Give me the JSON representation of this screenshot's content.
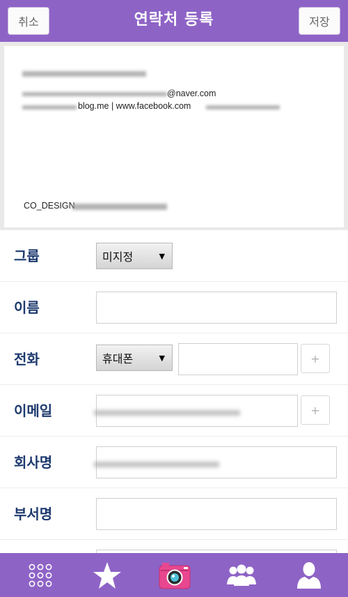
{
  "header": {
    "cancel_label": "취소",
    "title": "연락처 등록",
    "save_label": "저장"
  },
  "card": {
    "email_suffix": "@naver.com",
    "web_line": "blog.me | www.facebook.com",
    "name_line": "CO_DESIGN"
  },
  "form": {
    "group_label": "그룹",
    "group_value": "미지정",
    "name_label": "이름",
    "phone_label": "전화",
    "phone_type": "휴대폰",
    "email_label": "이메일",
    "company_label": "회사명",
    "dept_label": "부서명",
    "add_label": "+"
  },
  "colors": {
    "accent": "#8e63c6",
    "label": "#1d3a6e",
    "camera": "#e8478f"
  },
  "tabs": [
    "grid-icon",
    "star-icon",
    "camera-icon",
    "group-icon",
    "person-icon"
  ]
}
